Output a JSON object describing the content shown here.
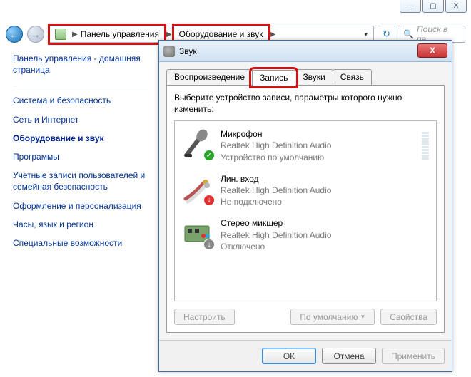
{
  "window_buttons": {
    "minimize": "—",
    "maximize": "▢",
    "close": "X"
  },
  "addressbar": {
    "crumb1": "Панель управления",
    "crumb2": "Оборудование и звук"
  },
  "search": {
    "placeholder": "Поиск в па..."
  },
  "sidebar": {
    "home": "Панель управления - домашняя страница",
    "items": [
      "Система и безопасность",
      "Сеть и Интернет",
      "Оборудование и звук",
      "Программы",
      "Учетные записи пользователей и семейная безопасность",
      "Оформление и персонализация",
      "Часы, язык и регион",
      "Специальные возможности"
    ],
    "active_index": 2
  },
  "dialog": {
    "title": "Звук",
    "tabs": [
      "Воспроизведение",
      "Запись",
      "Звуки",
      "Связь"
    ],
    "active_tab_index": 1,
    "instruction": "Выберите устройство записи, параметры которого нужно изменить:",
    "devices": [
      {
        "name": "Микрофон",
        "driver": "Realtek High Definition Audio",
        "status": "Устройство по умолчанию",
        "badge": "ok",
        "meter": true
      },
      {
        "name": "Лин. вход",
        "driver": "Realtek High Definition Audio",
        "status": "Не подключено",
        "badge": "down",
        "meter": false
      },
      {
        "name": "Стерео микшер",
        "driver": "Realtek High Definition Audio",
        "status": "Отключено",
        "badge": "off",
        "meter": false
      }
    ],
    "buttons": {
      "configure": "Настроить",
      "default": "По умолчанию",
      "properties": "Свойства",
      "ok": "ОК",
      "cancel": "Отмена",
      "apply": "Применить"
    }
  }
}
